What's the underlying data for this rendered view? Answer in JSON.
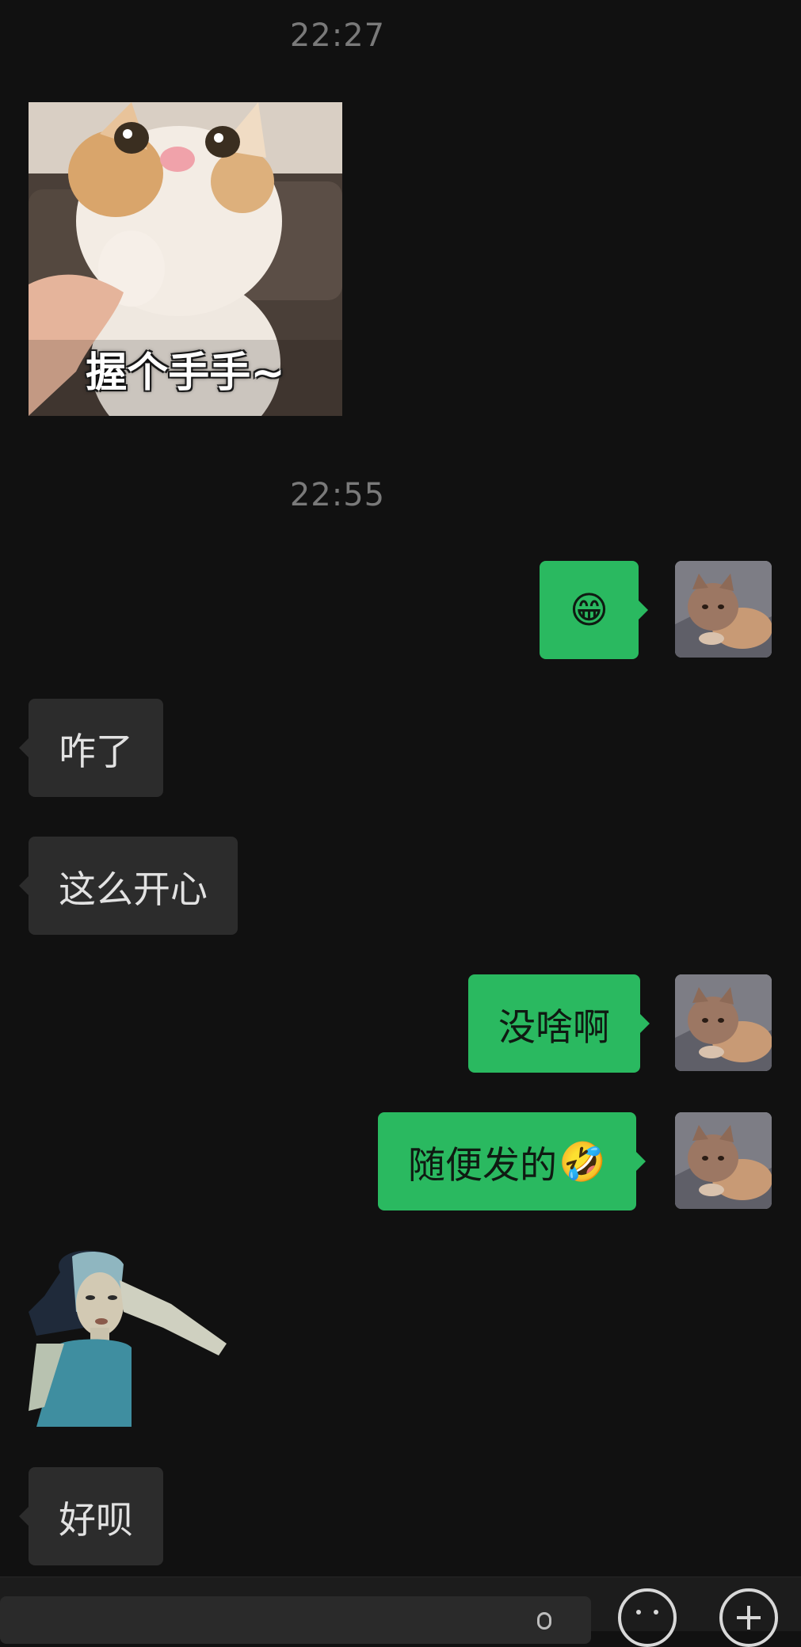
{
  "chat": {
    "timestamp_1": "22:27",
    "sticker_1_caption": "握个手手~",
    "timestamp_2": "22:55",
    "messages": [
      {
        "side": "right",
        "text": "😁"
      },
      {
        "side": "left",
        "text": "咋了"
      },
      {
        "side": "left",
        "text": "这么开心"
      },
      {
        "side": "right",
        "text": "没啥啊"
      },
      {
        "side": "right",
        "text": "随便发的",
        "emoji": "🤣"
      },
      {
        "side": "left",
        "text": "好呗"
      }
    ]
  },
  "icons": {
    "voice": "microphone-icon",
    "emoji": "smiley-icon",
    "more": "plus-icon"
  },
  "colors": {
    "background": "#111111",
    "incoming_bubble": "#2c2c2c",
    "outgoing_bubble": "#2ab960",
    "timestamp": "#7a7a7a"
  }
}
